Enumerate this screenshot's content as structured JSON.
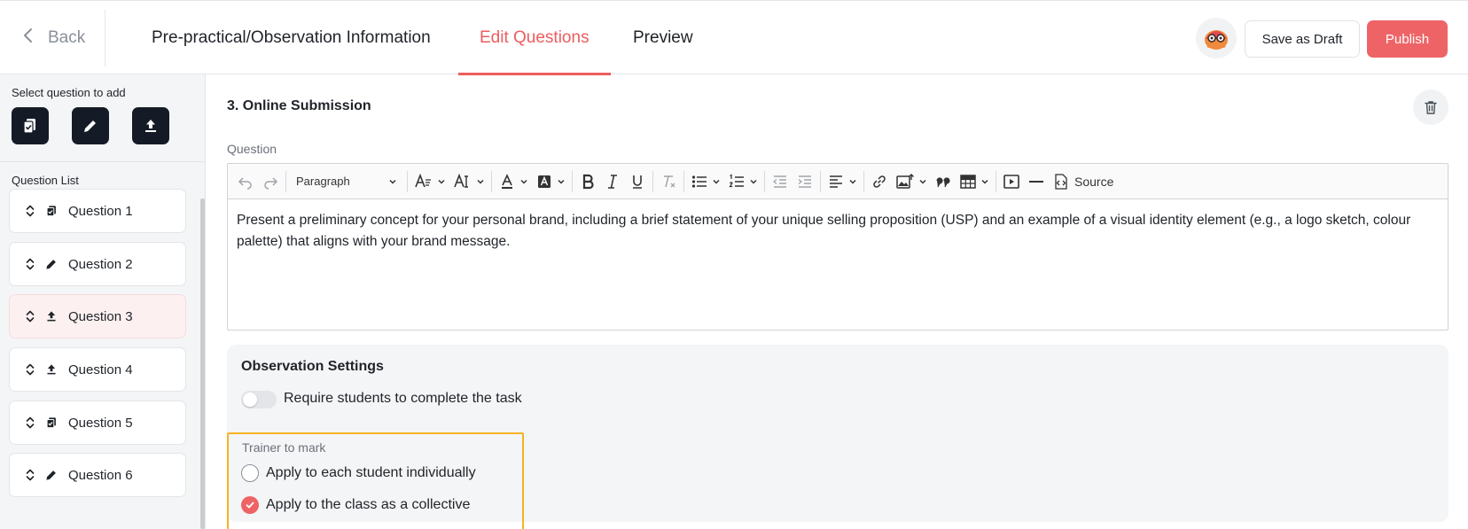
{
  "header": {
    "back_label": "Back",
    "tabs": [
      {
        "label": "Pre-practical/Observation Information",
        "active": false
      },
      {
        "label": "Edit Questions",
        "active": true
      },
      {
        "label": "Preview",
        "active": false
      }
    ],
    "save_draft_label": "Save as Draft",
    "publish_label": "Publish",
    "accent_color": "#ec5d5f"
  },
  "sidebar": {
    "add_label": "Select question to add",
    "add_buttons": [
      {
        "icon": "clipboard-check-icon"
      },
      {
        "icon": "pencil-icon"
      },
      {
        "icon": "upload-icon"
      }
    ],
    "list_label": "Question List",
    "questions": [
      {
        "label": "Question 1",
        "icon": "clipboard-check-icon",
        "selected": false
      },
      {
        "label": "Question 2",
        "icon": "pencil-icon",
        "selected": false
      },
      {
        "label": "Question 3",
        "icon": "upload-icon",
        "selected": true
      },
      {
        "label": "Question 4",
        "icon": "upload-icon",
        "selected": false
      },
      {
        "label": "Question 5",
        "icon": "clipboard-check-icon",
        "selected": false
      },
      {
        "label": "Question 6",
        "icon": "pencil-icon",
        "selected": false
      }
    ]
  },
  "main": {
    "question_title": "3. Online Submission",
    "question_label": "Question",
    "toolbar": {
      "paragraph_label": "Paragraph",
      "source_label": "Source"
    },
    "question_text": "Present a preliminary concept for your personal brand, including a brief statement of your unique selling proposition (USP) and an example of a visual identity element (e.g., a logo sketch, colour palette) that aligns with your brand message.",
    "settings": {
      "title": "Observation Settings",
      "require_label": "Require students to complete the task",
      "require_enabled": false,
      "trainer_label": "Trainer to mark",
      "options": [
        {
          "label": "Apply to each student individually",
          "checked": false
        },
        {
          "label": "Apply to the class as a collective",
          "checked": true
        }
      ]
    }
  }
}
